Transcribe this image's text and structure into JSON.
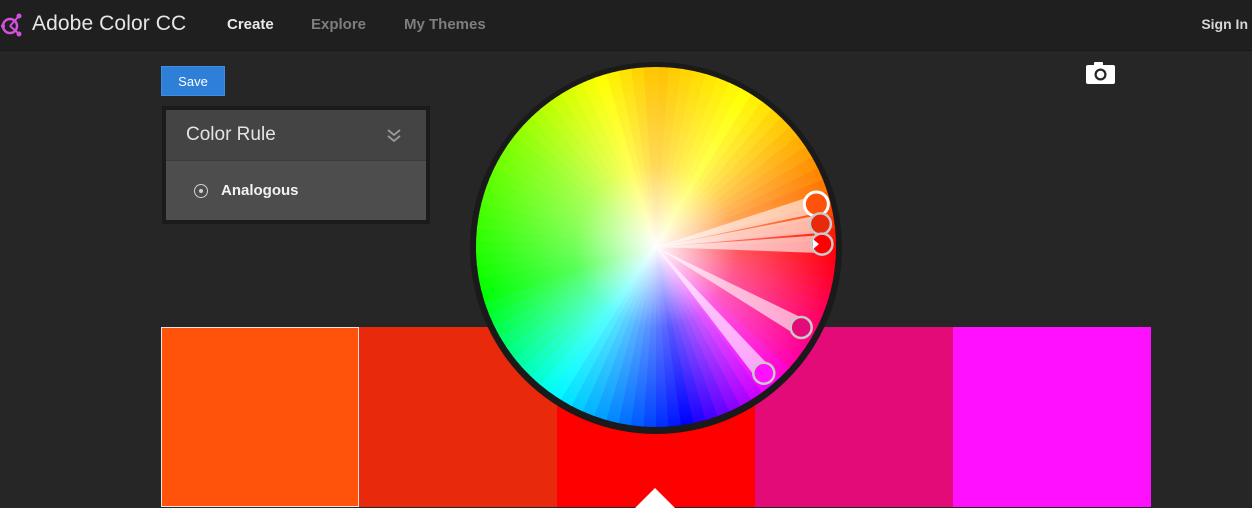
{
  "header": {
    "brand": "Adobe Color CC",
    "logo_icon": "adobe-color-logo-icon",
    "nav": [
      {
        "label": "Create",
        "active": true
      },
      {
        "label": "Explore",
        "active": false
      },
      {
        "label": "My Themes",
        "active": false
      }
    ],
    "sign_in": "Sign In"
  },
  "toolbar": {
    "save_label": "Save",
    "camera_icon": "camera-icon"
  },
  "color_rule": {
    "title": "Color Rule",
    "toggle_icon": "double-chevron-down-icon",
    "selected_option": "Analogous",
    "option_icon": "radio-selected-icon"
  },
  "swatches": [
    {
      "color": "#ff520a",
      "selected": true
    },
    {
      "color": "#e8290b",
      "selected": false
    },
    {
      "color": "#ff0000",
      "selected": false
    },
    {
      "color": "#e30b78",
      "selected": false
    },
    {
      "color": "#ff10ff",
      "selected": false
    }
  ],
  "base_swatch_index": 2,
  "wheel": {
    "handles": [
      {
        "color": "#ff520a",
        "hue": 20,
        "active": true
      },
      {
        "color": "#e8290b",
        "hue": 10,
        "active": false
      },
      {
        "color": "#ff0000",
        "hue": 0,
        "active": false,
        "base": true
      },
      {
        "color": "#e30b78",
        "hue": 330,
        "active": false
      },
      {
        "color": "#ff10ff",
        "hue": 300,
        "active": false
      }
    ]
  }
}
